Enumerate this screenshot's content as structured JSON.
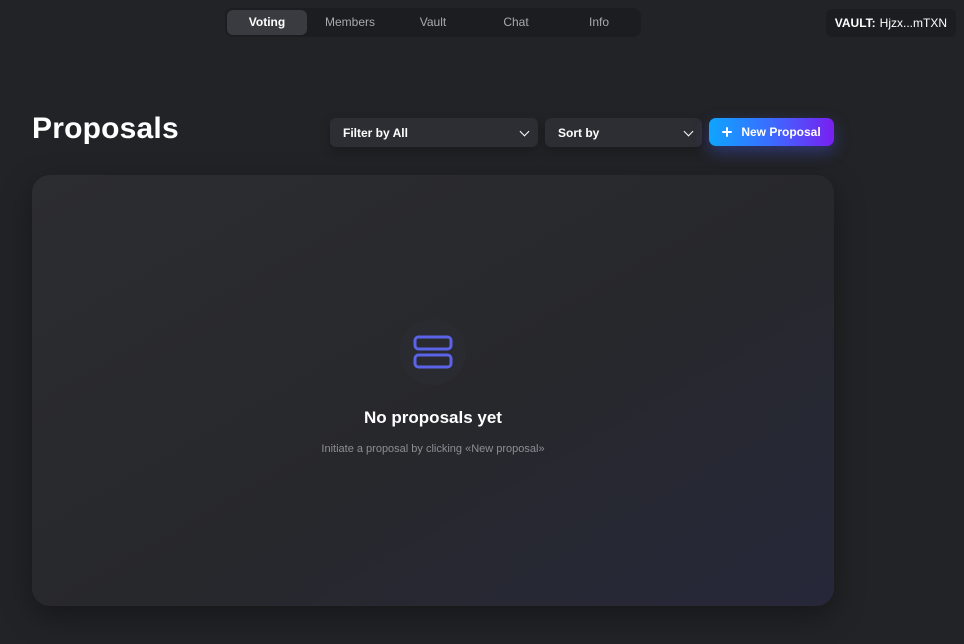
{
  "nav": {
    "tabs": [
      {
        "label": "Voting",
        "active": true
      },
      {
        "label": "Members",
        "active": false
      },
      {
        "label": "Vault",
        "active": false
      },
      {
        "label": "Chat",
        "active": false
      },
      {
        "label": "Info",
        "active": false
      }
    ]
  },
  "vault": {
    "label": "VAULT:",
    "address": "Hjzx...mTXN"
  },
  "page": {
    "title": "Proposals"
  },
  "filters": {
    "filter_label": "Filter by All",
    "sort_label": "Sort by"
  },
  "actions": {
    "new_proposal_label": "New Proposal"
  },
  "empty_state": {
    "title": "No proposals yet",
    "subtitle": "Initiate a proposal by clicking «New proposal»",
    "icon": "stack-icon"
  },
  "colors": {
    "background": "#222326",
    "panel": "#2b2c30",
    "accent_start": "#0ea5ff",
    "accent_end": "#7a1ff0",
    "icon_blue": "#5b63e8"
  }
}
